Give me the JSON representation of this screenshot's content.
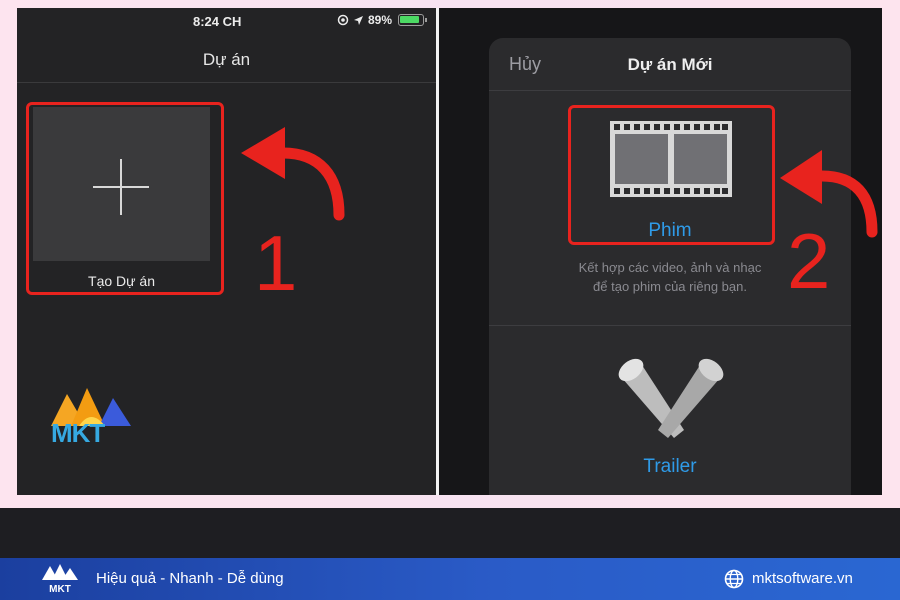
{
  "left_screen": {
    "status_time": "8:24 CH",
    "battery_percent": "89%",
    "nav_title": "Dự án",
    "create_label": "Tạo Dự án",
    "step_number": "1"
  },
  "right_screen": {
    "cancel_label": "Hủy",
    "sheet_title": "Dự án Mới",
    "movie_label": "Phim",
    "movie_desc_line1": "Kết hợp các video, ảnh và nhạc",
    "movie_desc_line2": "để tạo phim của riêng bạn.",
    "trailer_label": "Trailer",
    "step_number": "2"
  },
  "logo": {
    "text": "MKT"
  },
  "footer": {
    "logo_text": "MKT",
    "tagline": "Hiệu quả - Nhanh - Dễ dùng",
    "website": "mktsoftware.vn"
  },
  "colors": {
    "highlight_red": "#e8231e",
    "accent_blue": "#2f9be8",
    "footer_blue": "#2a5bc7"
  },
  "icons": [
    "plus-icon",
    "location-icon",
    "arrow-icon",
    "battery-icon",
    "film-strip-icon",
    "trailer-spotlight-icon",
    "curved-arrow-icon",
    "globe-icon"
  ]
}
